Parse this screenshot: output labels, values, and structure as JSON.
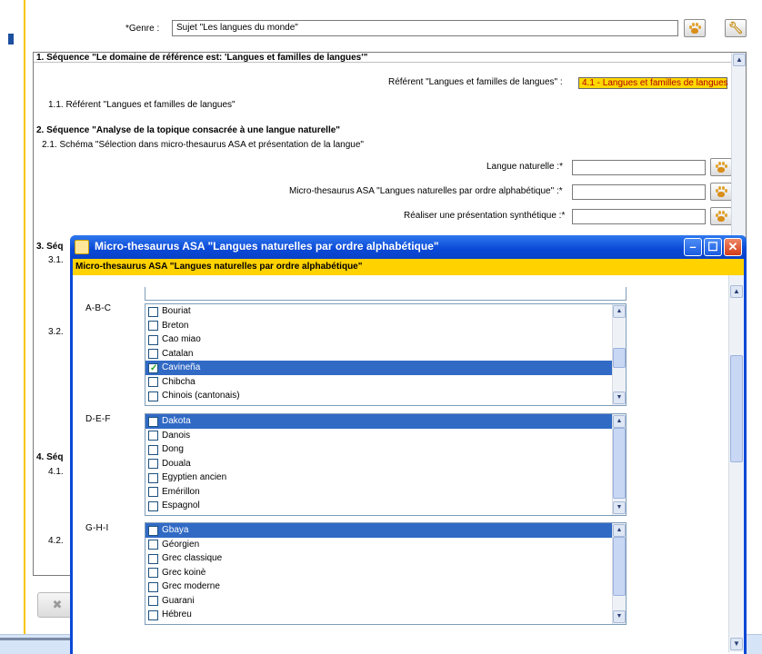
{
  "form": {
    "genre_label": "*Genre :",
    "genre_value": "Sujet \"Les langues du monde\"",
    "s1_title": "1. Séquence \"Le domaine de référence est: 'Langues et familles de langues'\"",
    "s1_ref_label": "Référent \"Langues et familles de langues\" :",
    "s1_ref_value": "4.1 - Langues et familles de langues",
    "s1_1": "1.1. Référent \"Langues et familles de langues\"",
    "s2_title": "2. Séquence \"Analyse de la topique consacrée à une langue naturelle\"",
    "s2_1": "2.1. Schéma \"Sélection dans micro-thesaurus ASA et présentation de la langue\"",
    "f_langue": "Langue naturelle :*",
    "f_micro": "Micro-thesaurus ASA \"Langues naturelles par ordre alphabétique\" :*",
    "f_pres": "Réaliser une présentation synthétique :*",
    "s3_title": "3. Séq",
    "s3_1": "3.1.",
    "s3_2": "3.2.",
    "s4_title": "4. Séq",
    "s4_1": "4.1.",
    "s4_2": "4.2."
  },
  "dialog": {
    "title": "Micro-thesaurus ASA \"Langues naturelles par ordre alphabétique\"",
    "header": "Micro-thesaurus ASA \"Langues naturelles par ordre alphabétique\"",
    "groups": [
      {
        "label": "A-B-C",
        "items": [
          {
            "label": "Bouriat",
            "checked": false,
            "selected": false
          },
          {
            "label": "Breton",
            "checked": false,
            "selected": false
          },
          {
            "label": "Cao miao",
            "checked": false,
            "selected": false
          },
          {
            "label": "Catalan",
            "checked": false,
            "selected": false
          },
          {
            "label": "Cavineña",
            "checked": true,
            "selected": true
          },
          {
            "label": "Chibcha",
            "checked": false,
            "selected": false
          },
          {
            "label": "Chinois (cantonais)",
            "checked": false,
            "selected": false
          }
        ]
      },
      {
        "label": "D-E-F",
        "items": [
          {
            "label": "Dakota",
            "checked": false,
            "selected": true
          },
          {
            "label": "Danois",
            "checked": false,
            "selected": false
          },
          {
            "label": "Dong",
            "checked": false,
            "selected": false
          },
          {
            "label": "Douala",
            "checked": false,
            "selected": false
          },
          {
            "label": "Egyptien ancien",
            "checked": false,
            "selected": false
          },
          {
            "label": "Emérillon",
            "checked": false,
            "selected": false
          },
          {
            "label": "Espagnol",
            "checked": false,
            "selected": false
          }
        ]
      },
      {
        "label": "G-H-I",
        "items": [
          {
            "label": "Gbaya",
            "checked": false,
            "selected": true
          },
          {
            "label": "Géorgien",
            "checked": false,
            "selected": false
          },
          {
            "label": "Grec classique",
            "checked": false,
            "selected": false
          },
          {
            "label": "Grec koinè",
            "checked": false,
            "selected": false
          },
          {
            "label": "Grec moderne",
            "checked": false,
            "selected": false
          },
          {
            "label": "Guarani",
            "checked": false,
            "selected": false
          },
          {
            "label": "Hébreu",
            "checked": false,
            "selected": false
          }
        ]
      }
    ]
  },
  "colors": {
    "title_bar": "#0a48d6",
    "header_yellow": "#ffd200",
    "selection": "#316ac5",
    "ref_badge": "#ffd800"
  }
}
